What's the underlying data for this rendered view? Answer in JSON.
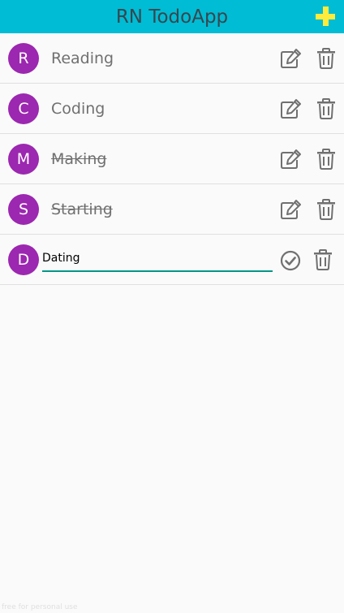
{
  "header": {
    "title": "RN TodoApp",
    "background_color": "#00bcd4",
    "add_icon": "plus-icon",
    "add_icon_color": "#ffeb3b"
  },
  "todos": [
    {
      "initial": "R",
      "text": "Reading",
      "completed": false,
      "editing": false
    },
    {
      "initial": "C",
      "text": "Coding",
      "completed": false,
      "editing": false
    },
    {
      "initial": "M",
      "text": "Making",
      "completed": true,
      "editing": false
    },
    {
      "initial": "S",
      "text": "Starting",
      "completed": true,
      "editing": false
    },
    {
      "initial": "D",
      "text": "Dating",
      "completed": false,
      "editing": true
    }
  ],
  "avatar_color": "#9c27b0",
  "icons": {
    "edit": "edit-icon",
    "delete": "trash-icon",
    "confirm": "check-circle-icon"
  },
  "watermark": "free for personal use"
}
